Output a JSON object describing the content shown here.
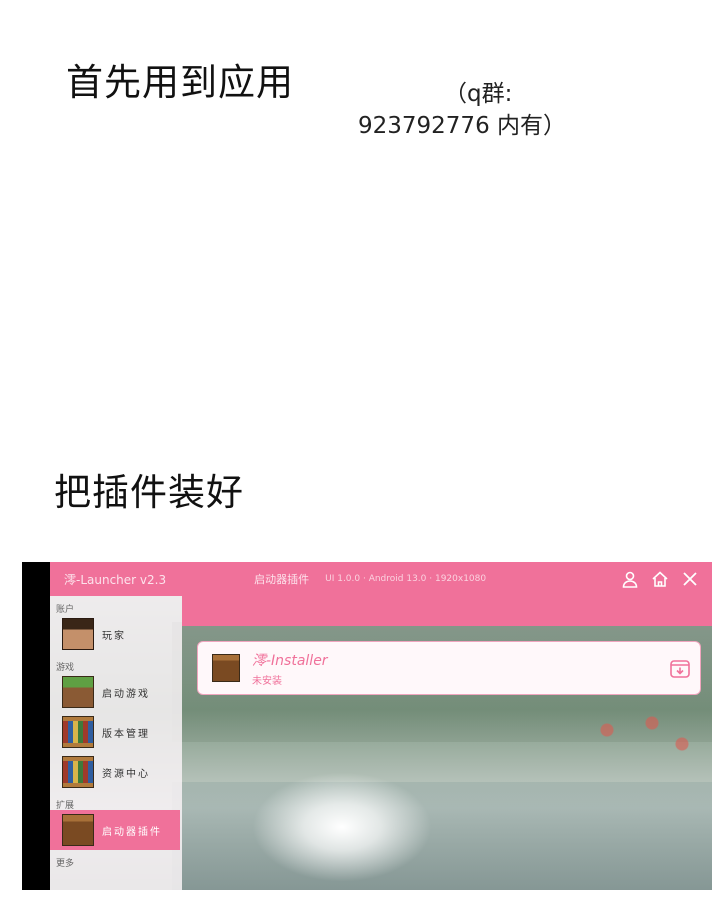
{
  "captions": {
    "step1": "首先用到应用",
    "note_line1": "（q群:",
    "note_line2": "923792776 内有）",
    "step2": "把插件装好"
  },
  "app": {
    "title": "澪-Launcher v2.3",
    "page_title": "启动器插件",
    "version_info": "UI 1.0.0 · Android 13.0 · 1920x1080",
    "accent_color": "#f0719a",
    "header_icons": [
      "user-icon",
      "home-icon",
      "close-icon"
    ],
    "sidebar": {
      "section_account": "账户",
      "account_name": "玩家",
      "section_game": "游戏",
      "items": [
        {
          "label": "启动游戏",
          "icon": "grass-block-icon"
        },
        {
          "label": "版本管理",
          "icon": "bookshelf-icon"
        },
        {
          "label": "资源中心",
          "icon": "bookshelf-icon"
        }
      ],
      "section_extra": "扩展",
      "active_item": {
        "label": "启动器插件",
        "icon": "crafting-table-icon"
      },
      "section_more": "更多"
    },
    "plugin_card": {
      "name": "澪-Installer",
      "status": "未安装",
      "action_icon": "download-icon"
    }
  }
}
